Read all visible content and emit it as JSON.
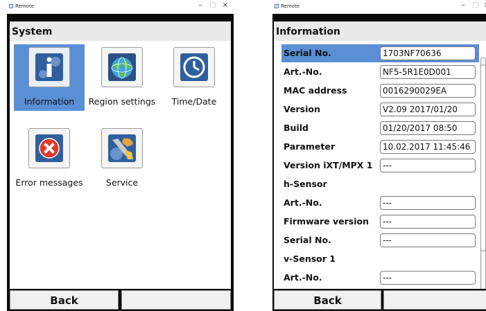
{
  "left_window": {
    "title": "Remote",
    "controls": [
      "–",
      "□",
      "×"
    ],
    "screen_title": "System",
    "tiles": [
      {
        "label": "Information",
        "icon": "information-icon",
        "selected": true
      },
      {
        "label": "Region settings",
        "icon": "globe-icon",
        "selected": false
      },
      {
        "label": "Time/Date",
        "icon": "clock-icon",
        "selected": false
      },
      {
        "label": "Error messages",
        "icon": "error-icon",
        "selected": false
      },
      {
        "label": "Service",
        "icon": "service-tools-icon",
        "selected": false
      }
    ],
    "footer": {
      "back_label": "Back",
      "right_label": ""
    }
  },
  "right_window": {
    "title": "Remote",
    "controls": [
      "–",
      "□",
      "×"
    ],
    "screen_title": "Information",
    "rows": [
      {
        "label": "Serial No.",
        "value": "1703NF70636",
        "selected": true
      },
      {
        "label": "Art.-No.",
        "value": "NF5-5R1E0D001"
      },
      {
        "label": "MAC address",
        "value": "0016290029EA"
      },
      {
        "label": "Version",
        "value": "V2.09 2017/01/20"
      },
      {
        "label": "Build",
        "value": "01/20/2017 08:50"
      },
      {
        "label": "Parameter",
        "value": "10.02.2017 11:45:46"
      },
      {
        "label": "Version iXT/MPX 1",
        "value": "---"
      },
      {
        "label": "h-Sensor",
        "value": null
      },
      {
        "label": "Art.-No.",
        "value": "---"
      },
      {
        "label": "Firmware version",
        "value": "---"
      },
      {
        "label": "Serial No.",
        "value": "---"
      },
      {
        "label": "v-Sensor 1",
        "value": null
      },
      {
        "label": "Art.-No.",
        "value": "---"
      }
    ],
    "footer": {
      "back_label": "Back",
      "right_label": ""
    }
  },
  "colors": {
    "selection": "#5a8fd6",
    "bezel": "#0b0b0b",
    "title_bar_bg": "#e9e9e9"
  }
}
